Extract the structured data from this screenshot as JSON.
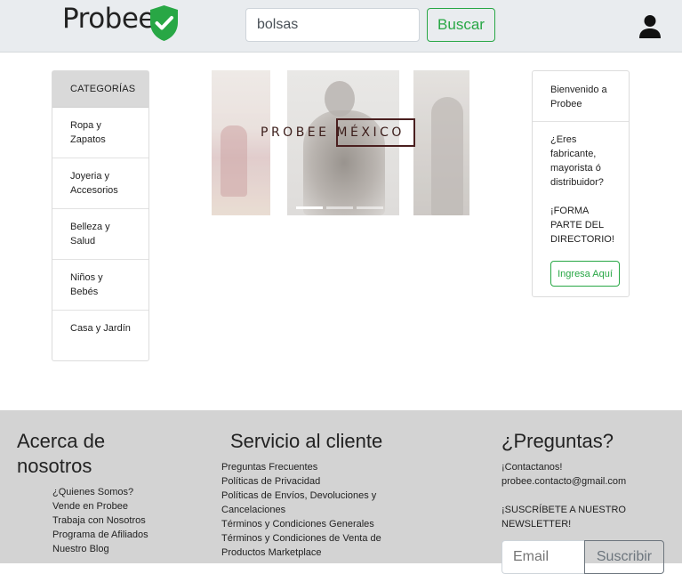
{
  "header": {
    "brand": "Probee",
    "search_value": "bolsas",
    "search_button": "Buscar",
    "icons": {
      "logo": "shield-check-icon",
      "user": "user-icon"
    },
    "colors": {
      "accent": "#28a745",
      "header_bg": "#e9ecef"
    }
  },
  "categories": {
    "title": "CATEGORÍAS",
    "items": [
      {
        "label": "Ropa y Zapatos"
      },
      {
        "label": "Joyeria y Accesorios"
      },
      {
        "label": "Belleza y Salud"
      },
      {
        "label": "Niños y Bebés"
      },
      {
        "label": "Casa y Jardín"
      }
    ]
  },
  "carousel": {
    "title": "PROBEE MÉXICO",
    "slides_count": 3,
    "active_slide": 1
  },
  "welcome": {
    "greeting": "Bienvenido a Probee",
    "question": "¿Eres fabricante, mayorista ó distribuidor?",
    "cta_text": "¡FORMA PARTE DEL DIRECTORIO!",
    "button": "Ingresa Aquí"
  },
  "footer": {
    "about": {
      "title": "Acerca de nosotros",
      "links": [
        "¿Quienes Somos?",
        "Vende en Probee",
        "Trabaja con Nosotros",
        "Programa de Afiliados",
        "Nuestro Blog"
      ]
    },
    "service": {
      "title": "Servicio al cliente",
      "links": [
        "Preguntas Frecuentes",
        "Políticas de Privacidad",
        "Políticas de Envíos, Devoluciones y Cancelaciones",
        "Términos y Condiciones Generales",
        "Términos y Condiciones de Venta de Productos Marketplace"
      ]
    },
    "questions": {
      "title": "¿Preguntas?",
      "contact_label": "¡Contactanos!",
      "email": "probee.contacto@gmail.com",
      "newsletter_label": "¡SUSCRÍBETE A NUESTRO NEWSLETTER!",
      "email_placeholder": "Email",
      "subscribe_button": "Suscribir"
    },
    "colors": {
      "footer_bg": "#d3d3d3"
    }
  }
}
